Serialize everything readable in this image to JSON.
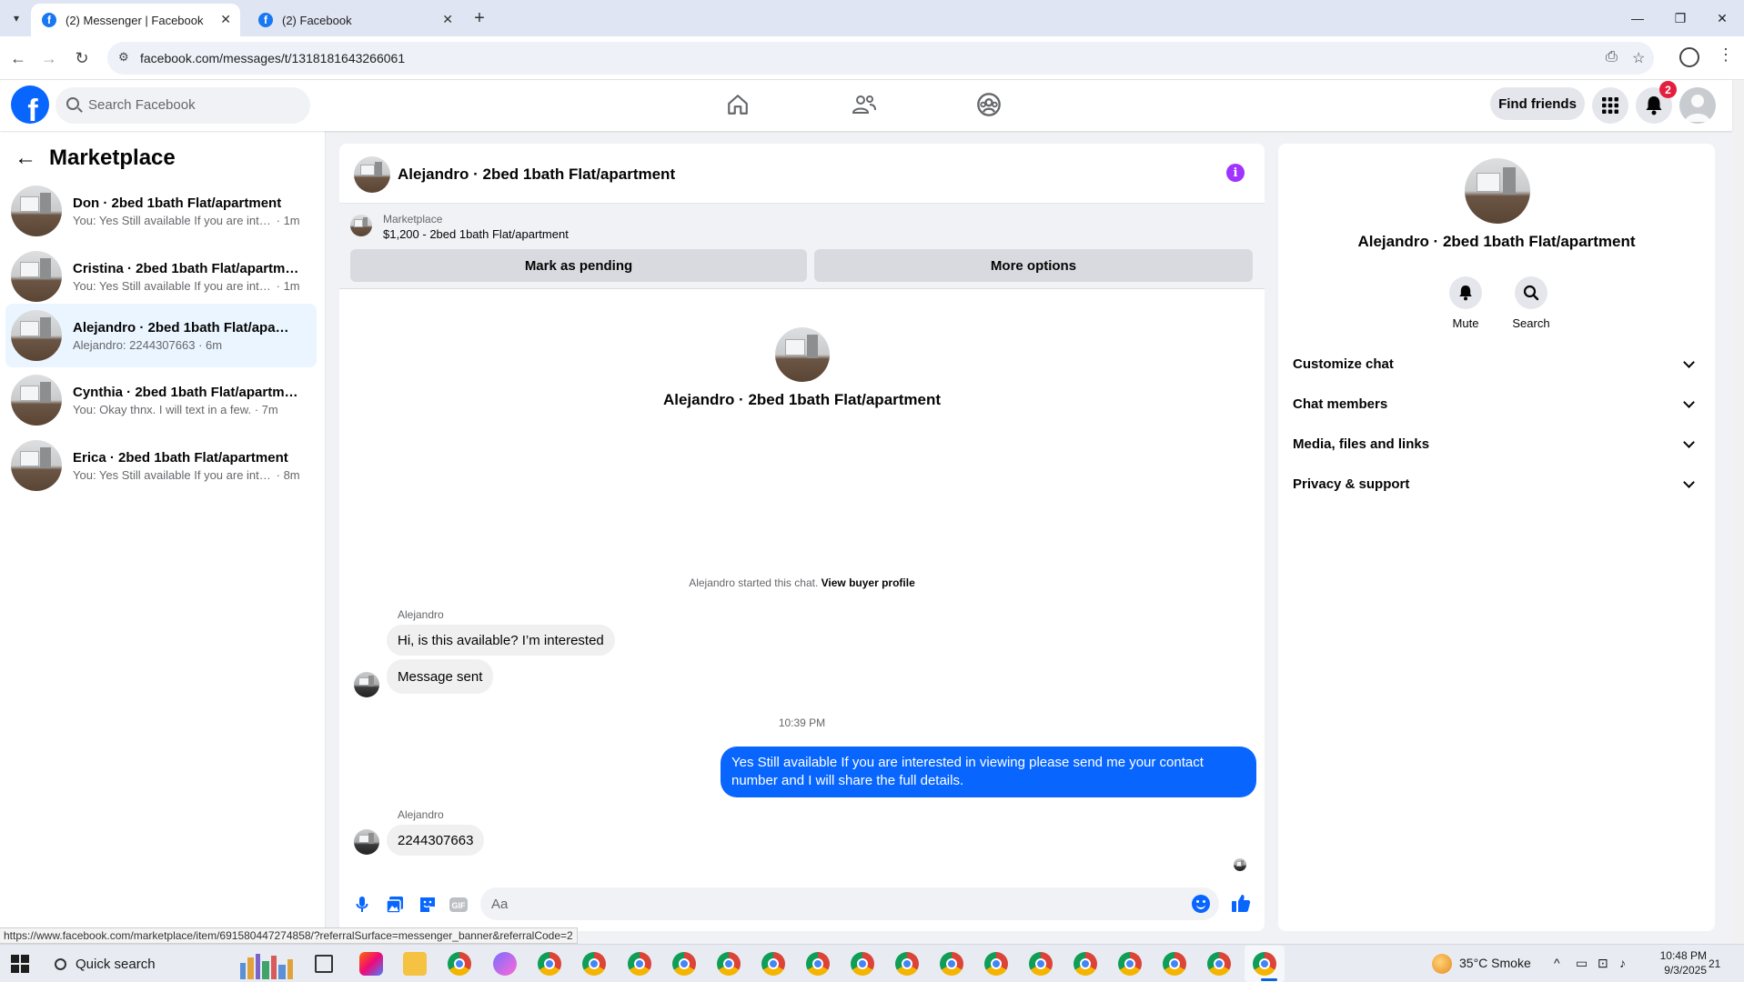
{
  "browser": {
    "tabs": [
      {
        "title": "(2) Messenger | Facebook",
        "active": true
      },
      {
        "title": "(2) Facebook",
        "active": false
      }
    ],
    "url": "facebook.com/messages/t/1318181643266061",
    "status_url": "https://www.facebook.com/marketplace/item/691580447274858/?referralSurface=messenger_banner&referralCode=2"
  },
  "fbnav": {
    "logo": "f",
    "search_placeholder": "Search Facebook",
    "find_friends": "Find friends",
    "notification_count": "2"
  },
  "sidebar": {
    "title": "Marketplace",
    "conversations": [
      {
        "name": "Don · 2bed 1bath Flat/apartment",
        "snippet": "You: Yes Still available If you are interested in viewing",
        "time": "· 1m",
        "selected": false
      },
      {
        "name": "Cristina · 2bed 1bath Flat/apartment",
        "snippet": "You: Yes Still available If you are interested in viewing",
        "time": "· 1m",
        "selected": false
      },
      {
        "name": "Alejandro · 2bed 1bath Flat/apartment",
        "snippet": "Alejandro: 2244307663",
        "time": "· 6m",
        "selected": true
      },
      {
        "name": "Cynthia · 2bed 1bath Flat/apartment",
        "snippet": "You: Okay thnx. I will text in a few.",
        "time": "· 7m",
        "selected": false
      },
      {
        "name": "Erica · 2bed 1bath Flat/apartment",
        "snippet": "You: Yes Still available If you are interested in viewing",
        "time": "· 8m",
        "selected": false
      }
    ]
  },
  "chat": {
    "title": "Alejandro · 2bed 1bath Flat/apartment",
    "marketplace_label": "Marketplace",
    "listing": "$1,200 - 2bed 1bath Flat/apartment",
    "mark_pending": "Mark as pending",
    "more_options": "More options",
    "intro_name": "Alejandro · 2bed 1bath Flat/apartment",
    "started_text": "Alejandro started this chat.",
    "view_profile": "View buyer profile",
    "messages": [
      {
        "sender": "Alejandro",
        "text": "Hi, is this available? I’m interested",
        "direction": "in"
      },
      {
        "text": "Message sent",
        "direction": "in"
      },
      {
        "timestamp": "10:39 PM"
      },
      {
        "text": "Yes Still available If you are interested in viewing please send me your contact number and I will share the full details.",
        "direction": "out"
      },
      {
        "sender": "Alejandro",
        "text": "2244307663",
        "direction": "in"
      }
    ],
    "composer_placeholder": "Aa"
  },
  "info": {
    "name": "Alejandro · 2bed 1bath Flat/apartment",
    "actions": [
      "Mute",
      "Search"
    ],
    "sections": [
      "Customize chat",
      "Chat members",
      "Media, files and links",
      "Privacy & support"
    ]
  },
  "taskbar": {
    "search": "Quick search",
    "weather": "35°C  Smoke",
    "time": "10:48 PM",
    "date": "9/3/2025",
    "notif": "21"
  },
  "colors": {
    "fb_blue": "#0866ff",
    "selected_row": "#ebf5ff",
    "info_icon": "#a033ff",
    "badge_red": "#e41e3f"
  }
}
